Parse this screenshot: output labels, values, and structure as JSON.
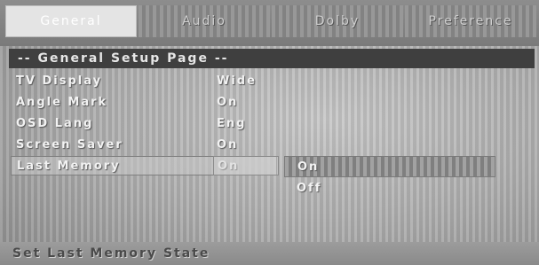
{
  "tabs": [
    {
      "label": "General",
      "active": true
    },
    {
      "label": "Audio",
      "active": false
    },
    {
      "label": "Dolby",
      "active": false
    },
    {
      "label": "Preference",
      "active": false
    }
  ],
  "header": {
    "title": "-- General Setup Page --"
  },
  "settings": [
    {
      "label": "TV Display",
      "value": "Wide"
    },
    {
      "label": "Angle Mark",
      "value": "On"
    },
    {
      "label": "OSD Lang",
      "value": "Eng"
    },
    {
      "label": "Screen Saver",
      "value": "On"
    },
    {
      "label": "Last Memory",
      "value": "On",
      "selected": true
    }
  ],
  "options": [
    {
      "label": "On",
      "highlighted": true
    },
    {
      "label": "Off",
      "highlighted": false
    }
  ],
  "status": {
    "text": "Set Last Memory State"
  }
}
